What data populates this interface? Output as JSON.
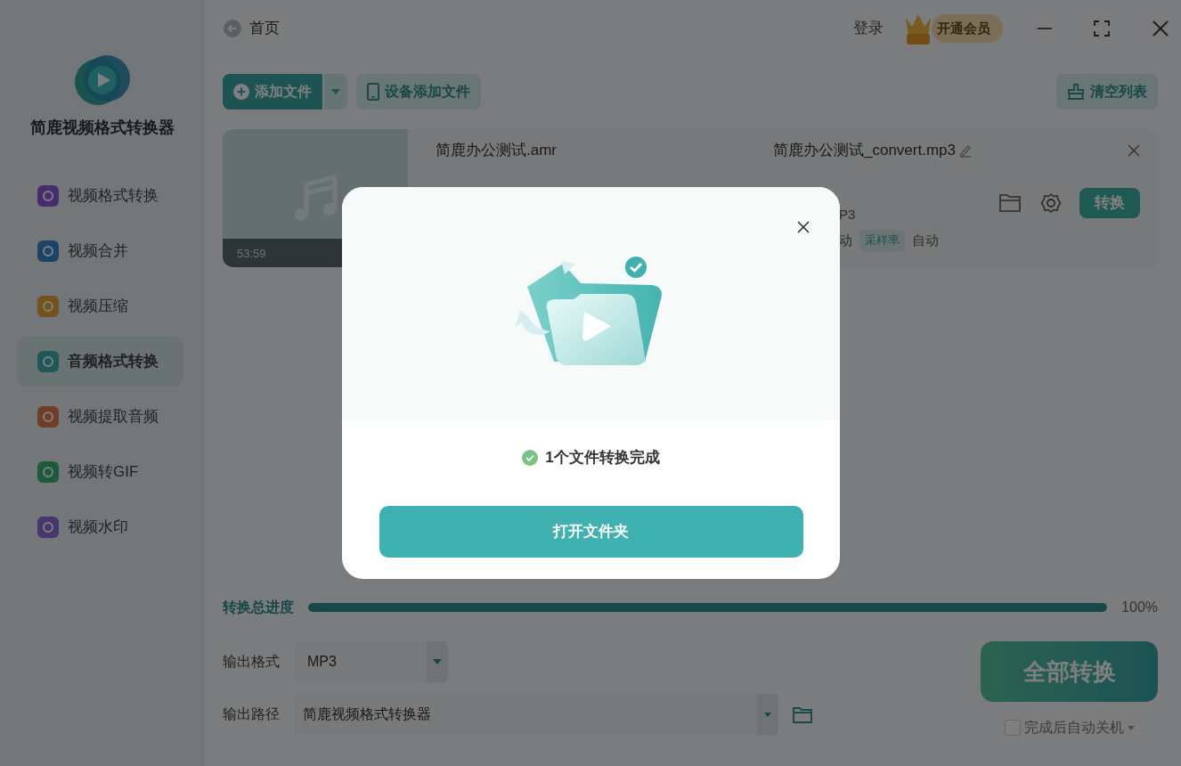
{
  "app": {
    "name": "简鹿视频格式转换器"
  },
  "sidebar": {
    "items": [
      {
        "label": "视频格式转换",
        "color": "#452e6b",
        "selected": false
      },
      {
        "label": "视频合并",
        "color": "#1d4368",
        "selected": false
      },
      {
        "label": "视频压缩",
        "color": "#74531a",
        "selected": false
      },
      {
        "label": "音频格式转换",
        "color": "#1f5858",
        "selected": true
      },
      {
        "label": "视频提取音频",
        "color": "#703d29",
        "selected": false
      },
      {
        "label": "视频转GIF",
        "color": "#1e5939",
        "selected": false
      },
      {
        "label": "视频水印",
        "color": "#47376e",
        "selected": false
      }
    ]
  },
  "header": {
    "back_label": "首页",
    "login": "登录",
    "vip_label": "开通会员"
  },
  "toolbar": {
    "add_file": "添加文件",
    "device_add": "设备添加文件",
    "clear_list": "清空列表"
  },
  "files": [
    {
      "duration": "53:59",
      "source_name": "简鹿办公测试.amr",
      "output_name": "简鹿办公测试_convert.mp3",
      "format_fragment": "P3",
      "bitrate_fragment": "动",
      "sample_rate_label": "采样率",
      "sample_rate": "自动",
      "convert_button": "转换"
    }
  ],
  "progress": {
    "label": "转换总进度",
    "level": 1.0,
    "reading": "100%"
  },
  "output": {
    "format_label": "输出格式",
    "format": "MP3",
    "path_label": "输出路径",
    "path": "简鹿视频格式转换器"
  },
  "convert_all": "全部转换",
  "auto_shutdown": {
    "label": "完成后自动关机",
    "checked": false
  },
  "dialog": {
    "message": "1个文件转换完成",
    "button": "打开文件夹"
  }
}
